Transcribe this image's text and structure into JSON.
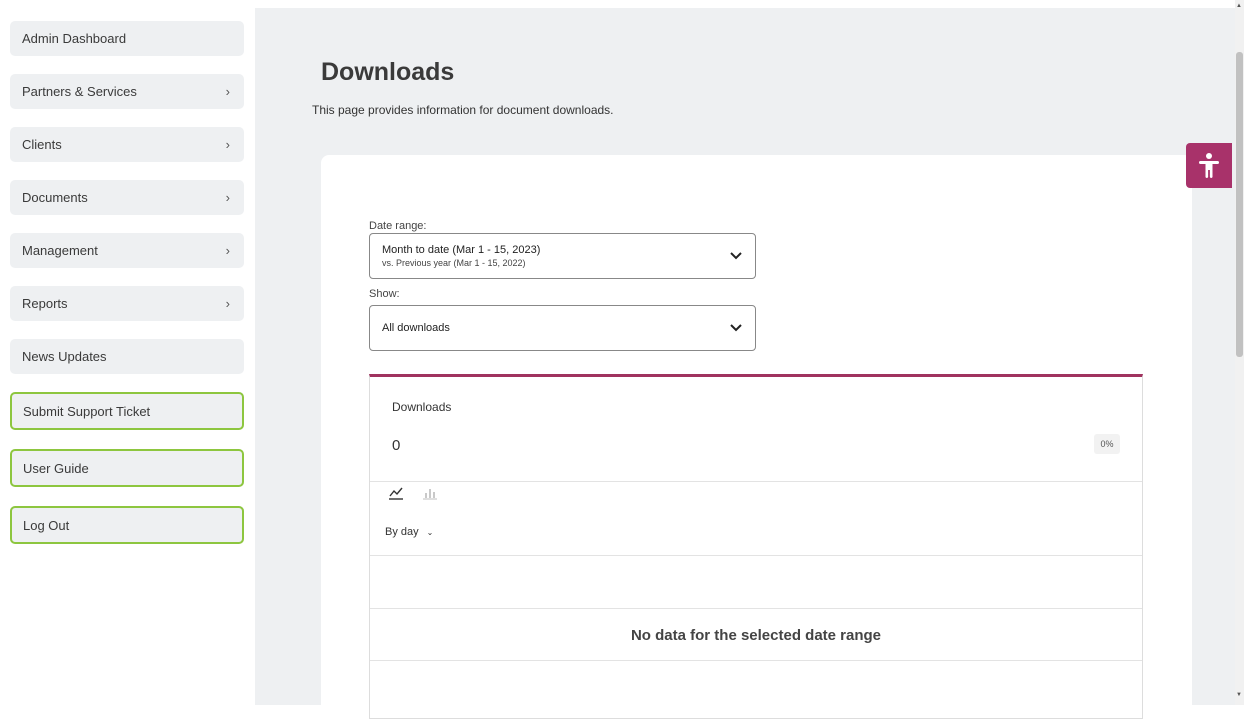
{
  "sidebar": {
    "items": [
      {
        "label": "Admin Dashboard",
        "chevron": false
      },
      {
        "label": "Partners & Services",
        "chevron": true
      },
      {
        "label": "Clients",
        "chevron": true
      },
      {
        "label": "Documents",
        "chevron": true
      },
      {
        "label": "Management",
        "chevron": true
      },
      {
        "label": "Reports",
        "chevron": true
      },
      {
        "label": "News Updates",
        "chevron": false
      }
    ],
    "outlined_items": [
      {
        "label": "Submit Support Ticket"
      },
      {
        "label": "User Guide"
      },
      {
        "label": "Log Out"
      }
    ],
    "chevron_glyph": "›",
    "outline_color": "#8dc63f"
  },
  "header": {
    "title": "Downloads",
    "subtitle": "This page provides information for document downloads."
  },
  "filters": {
    "date_range_label": "Date range:",
    "date_range_value": "Month to date (Mar 1 - 15, 2023)",
    "date_range_compare": "vs. Previous year (Mar 1 - 15, 2022)",
    "show_label": "Show:",
    "show_value": "All downloads"
  },
  "stats": {
    "title": "Downloads",
    "value": "0",
    "change": "0%",
    "accent_color": "#a0335f",
    "chart_icons": [
      "line-chart-icon",
      "bar-chart-icon"
    ],
    "granularity": "By day",
    "empty_message": "No data for the selected date range"
  },
  "accessibility": {
    "icon": "accessibility-icon",
    "color": "#a8326a"
  }
}
